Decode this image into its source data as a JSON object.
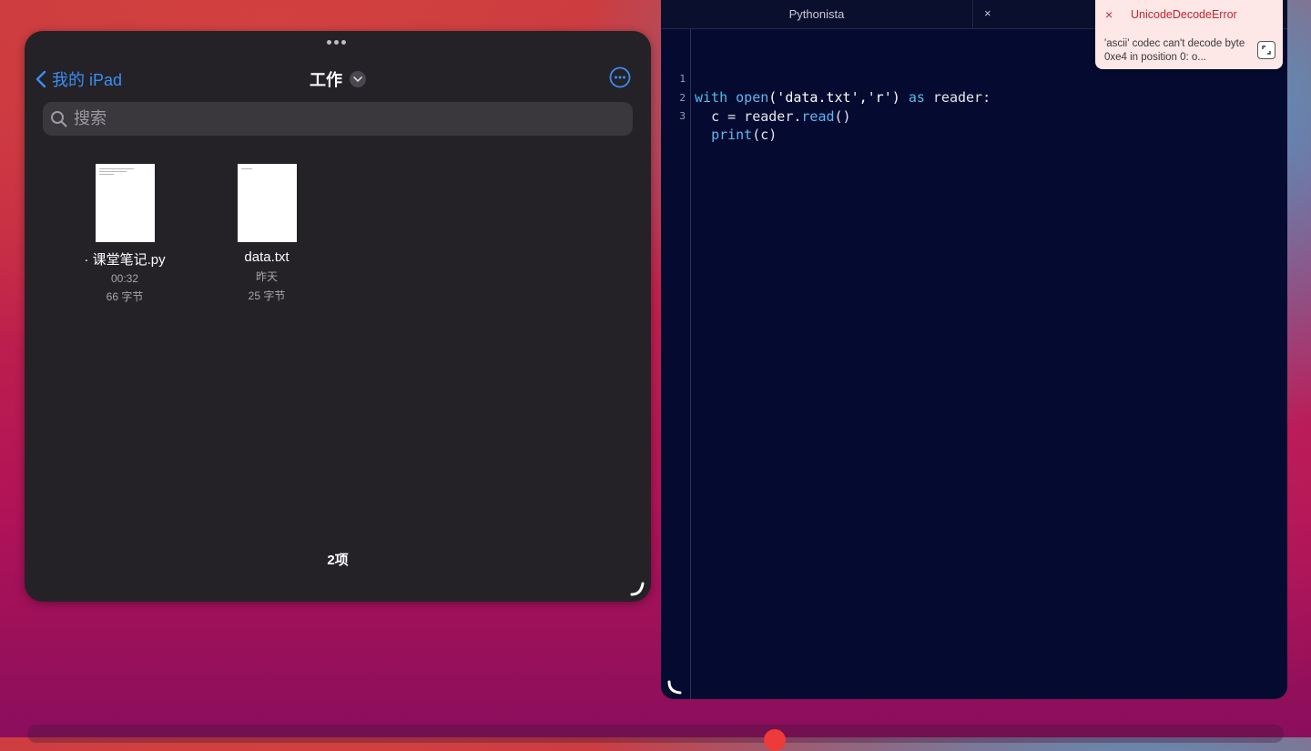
{
  "files_app": {
    "back_label": "我的 iPad",
    "folder_title": "工作",
    "search_placeholder": "搜索",
    "files": [
      {
        "name": "· 课堂笔记.py",
        "date": "00:32",
        "size": "66 字节"
      },
      {
        "name": "data.txt",
        "date": "昨天",
        "size": "25 字节"
      }
    ],
    "item_count": "2项",
    "accent_color": "#3b8df5"
  },
  "pythonista": {
    "tab_title": "Pythonista",
    "tab_close": "×",
    "line_numbers": [
      "1",
      "2",
      "3"
    ],
    "code": {
      "line1": {
        "kw1": "with",
        "fn": "open",
        "args": "('data.txt','r')",
        "kw2": "as",
        "rest": "reader:"
      },
      "line2": {
        "lhs": "c = reader.",
        "fn": "read",
        "rest": "()"
      },
      "line3": {
        "fn": "print",
        "rest": "(c)"
      }
    },
    "background_color": "#050a30"
  },
  "error": {
    "close": "×",
    "title": "UnicodeDecodeError",
    "message": "'ascii' codec can't decode byte 0xe4 in position 0: o...",
    "color": "#c0262c"
  },
  "icons": [
    "chevron-left-icon",
    "chevron-down-icon",
    "more-icon",
    "search-icon",
    "resize-handle-icon",
    "phone-icon",
    "expand-icon"
  ]
}
